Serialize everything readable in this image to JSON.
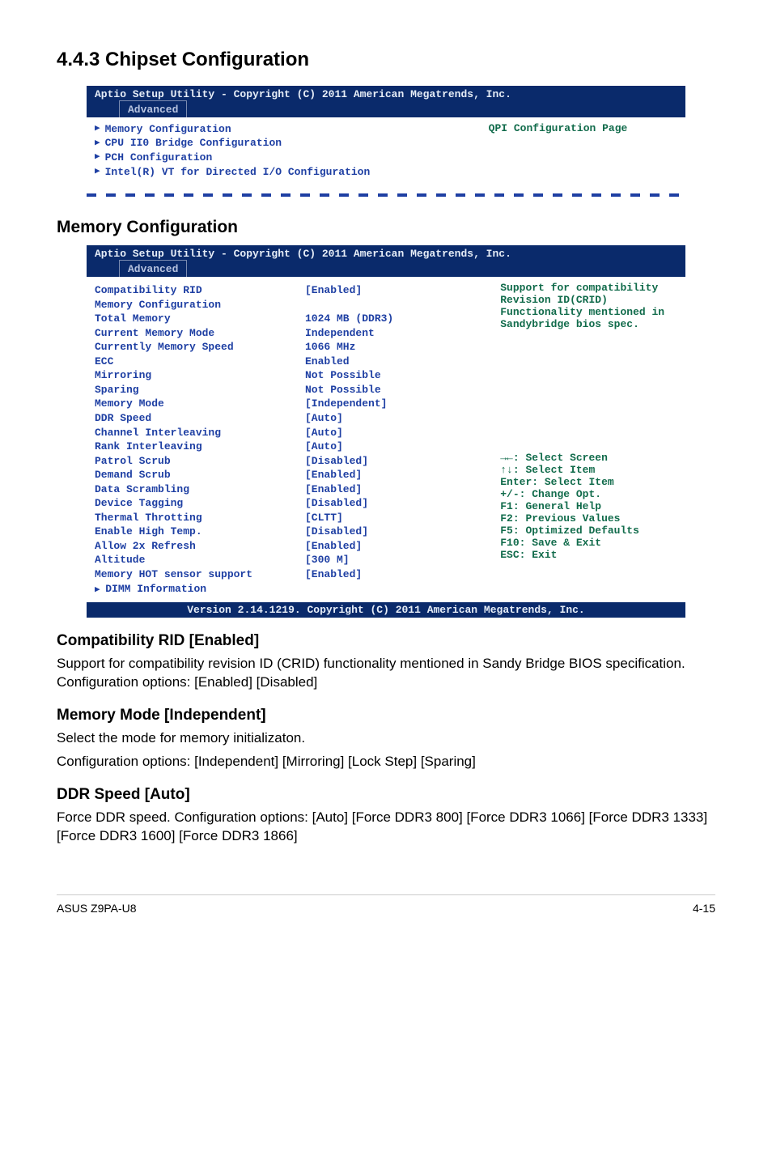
{
  "page": {
    "title": "4.4.3     Chipset Configuration",
    "footer_left": "ASUS Z9PA-U8",
    "footer_right": "4-15"
  },
  "bios1": {
    "header": "   Aptio Setup Utility - Copyright (C) 2011 American Megatrends, Inc.",
    "tab": "Advanced",
    "items": [
      "Memory Configuration",
      "CPU II0 Bridge Configuration",
      "PCH Configuration",
      "Intel(R) VT for Directed I/O Configuration"
    ],
    "help": "QPI Configuration Page"
  },
  "memcfg_heading": "Memory Configuration",
  "bios2": {
    "header": "   Aptio Setup Utility - Copyright (C) 2011 American Megatrends, Inc.",
    "tab": "Advanced",
    "rows": [
      {
        "label": "Compatibility RID",
        "value": "[Enabled]"
      },
      {
        "label": "",
        "value": ""
      },
      {
        "label": "Memory Configuration",
        "value": ""
      },
      {
        "label": "",
        "value": ""
      },
      {
        "label": "Total Memory",
        "value": "1024 MB (DDR3)"
      },
      {
        "label": "Current Memory Mode",
        "value": "Independent"
      },
      {
        "label": "Currently Memory Speed",
        "value": "1066 MHz"
      },
      {
        "label": "ECC",
        "value": "Enabled"
      },
      {
        "label": "Mirroring",
        "value": "Not Possible"
      },
      {
        "label": "Sparing",
        "value": "Not Possible"
      },
      {
        "label": "Memory Mode",
        "value": "[Independent]"
      },
      {
        "label": "DDR Speed",
        "value": "[Auto]"
      },
      {
        "label": "Channel Interleaving",
        "value": "[Auto]"
      },
      {
        "label": "Rank Interleaving",
        "value": "[Auto]"
      },
      {
        "label": "Patrol Scrub",
        "value": "[Disabled]"
      },
      {
        "label": "Demand Scrub",
        "value": "[Enabled]"
      },
      {
        "label": "Data Scrambling",
        "value": "[Enabled]"
      },
      {
        "label": "Device Tagging",
        "value": "[Disabled]"
      },
      {
        "label": "Thermal Throtting",
        "value": "[CLTT]"
      },
      {
        "label": "Enable High Temp.",
        "value": "[Disabled]"
      },
      {
        "label": "Allow 2x Refresh",
        "value": "[Enabled]"
      },
      {
        "label": "Altitude",
        "value": "[300 M]"
      },
      {
        "label": "Memory HOT sensor support",
        "value": "[Enabled]"
      },
      {
        "label": "DIMM Information",
        "value": "",
        "submenu": true
      }
    ],
    "help_top": [
      "Support for compatibility",
      "Revision ID(CRID)",
      "Functionality mentioned in",
      "Sandybridge bios spec."
    ],
    "help_keys": [
      "→←: Select Screen",
      "↑↓:  Select Item",
      "Enter: Select Item",
      "+/-: Change Opt.",
      "F1: General Help",
      "F2: Previous Values",
      "F5: Optimized Defaults",
      "F10: Save & Exit",
      "ESC: Exit"
    ],
    "footer": "Version 2.14.1219. Copyright (C) 2011 American Megatrends, Inc."
  },
  "sections": {
    "compat": {
      "heading": "Compatibility RID [Enabled]",
      "p": "Support for compatibility revision ID (CRID) functionality mentioned in Sandy Bridge BIOS specification. Configuration options: [Enabled] [Disabled]"
    },
    "memmode": {
      "heading": "Memory Mode [Independent]",
      "p1": "Select the mode for memory initializaton.",
      "p2": "Configuration options: [Independent] [Mirroring] [Lock Step] [Sparing]"
    },
    "ddr": {
      "heading": "DDR Speed [Auto]",
      "p": "Force DDR speed. Configuration options: [Auto] [Force DDR3 800] [Force DDR3 1066] [Force DDR3 1333] [Force DDR3 1600] [Force DDR3 1866]"
    }
  }
}
